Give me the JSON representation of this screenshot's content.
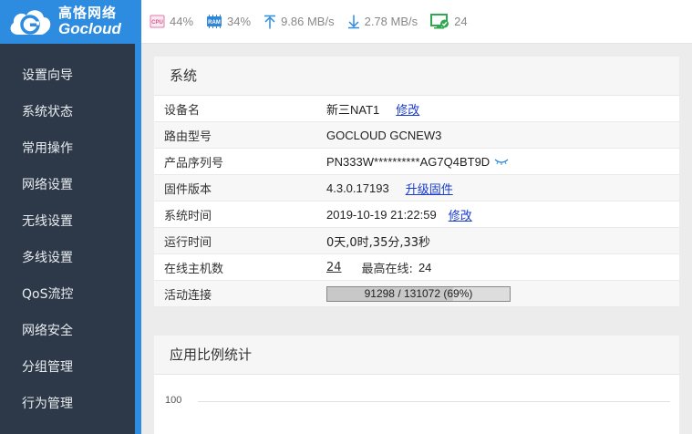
{
  "brand": {
    "name_cn": "高恪网络",
    "name_en": "Gocloud",
    "color": "#2d8be0"
  },
  "topbar": {
    "cpu": {
      "icon": "cpu-icon",
      "badge": "CPU",
      "value": "44%"
    },
    "ram": {
      "icon": "ram-icon",
      "badge": "RAM",
      "value": "34%"
    },
    "upload": {
      "icon": "upload-arrow-icon",
      "value": "9.86 MB/s"
    },
    "download": {
      "icon": "download-arrow-icon",
      "value": "2.78 MB/s"
    },
    "hosts": {
      "icon": "monitor-check-icon",
      "value": "24"
    }
  },
  "sidebar": {
    "items": [
      {
        "label": "设置向导"
      },
      {
        "label": "系统状态"
      },
      {
        "label": "常用操作"
      },
      {
        "label": "网络设置"
      },
      {
        "label": "无线设置"
      },
      {
        "label": "多线设置"
      },
      {
        "label": "QoS流控"
      },
      {
        "label": "网络安全"
      },
      {
        "label": "分组管理"
      },
      {
        "label": "行为管理"
      }
    ]
  },
  "system": {
    "title": "系统",
    "device_name": {
      "label": "设备名",
      "value": "新三NAT1",
      "action": "修改"
    },
    "model": {
      "label": "路由型号",
      "value": "GOCLOUD GCNEW3"
    },
    "serial": {
      "label": "产品序列号",
      "value": "PN333W**********AG7Q4BT9D",
      "icon": "eye-closed-icon"
    },
    "firmware": {
      "label": "固件版本",
      "value": "4.3.0.17193",
      "action": "升级固件"
    },
    "time": {
      "label": "系统时间",
      "value": "2019-10-19 21:22:59",
      "action": "修改"
    },
    "uptime": {
      "label": "运行时间",
      "value": "0天,0时,35分,33秒"
    },
    "online": {
      "label": "在线主机数",
      "value": "24",
      "max_label": "最高在线:",
      "max_value": "24"
    },
    "connections": {
      "label": "活动连接",
      "value": "91298 / 131072 (69%)",
      "fraction": 0.69
    }
  },
  "app_stats": {
    "title": "应用比例统计",
    "tick_top": "100"
  }
}
